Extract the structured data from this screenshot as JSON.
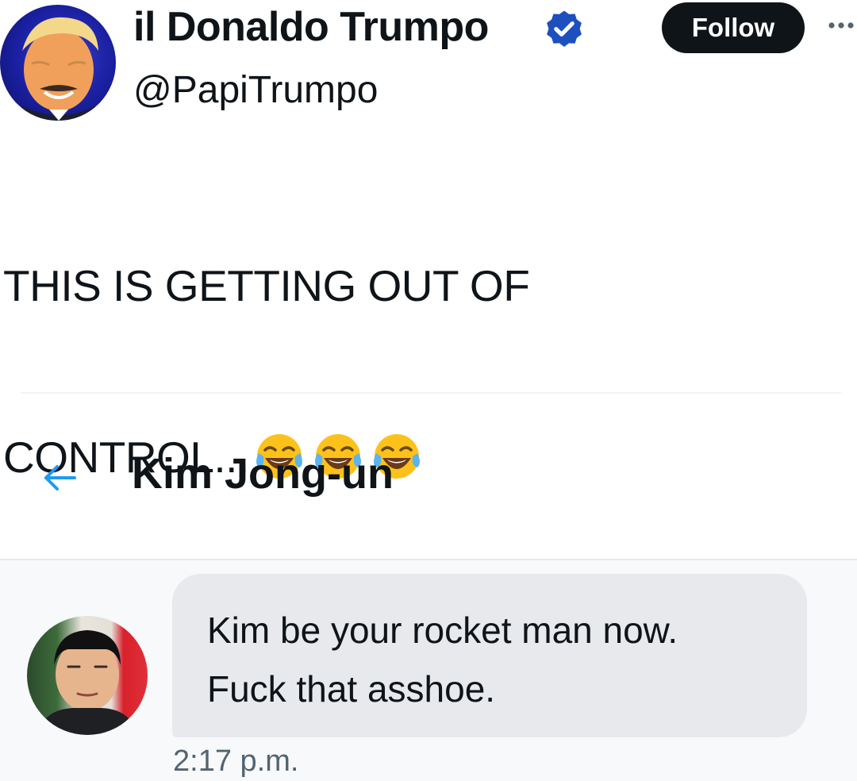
{
  "tweet": {
    "author_name": "il Donaldo Trumpo",
    "handle": "@PapiTrumpo",
    "verified_icon": "verified-badge-icon",
    "follow_label": "Follow",
    "more_icon": "more-dots-icon",
    "text_line1": "THIS IS GETTING OUT OF",
    "text_line2": "CONTROL...",
    "emojis": [
      "face-with-tears-of-joy-icon",
      "face-with-tears-of-joy-icon",
      "face-with-tears-of-joy-icon"
    ]
  },
  "dm": {
    "back_icon": "back-arrow-icon",
    "conversation_name": "Kim Jong-un",
    "message_line1": "Kim be your rocket man now.",
    "message_line2": "Fuck that asshoe.",
    "timestamp": "2:17 p.m."
  },
  "colors": {
    "accent_blue": "#1d9bf0",
    "verified_blue": "#1d4fbf",
    "follow_bg": "#0f1419",
    "bubble_bg": "#e7e9ec",
    "text_secondary": "#536471"
  }
}
